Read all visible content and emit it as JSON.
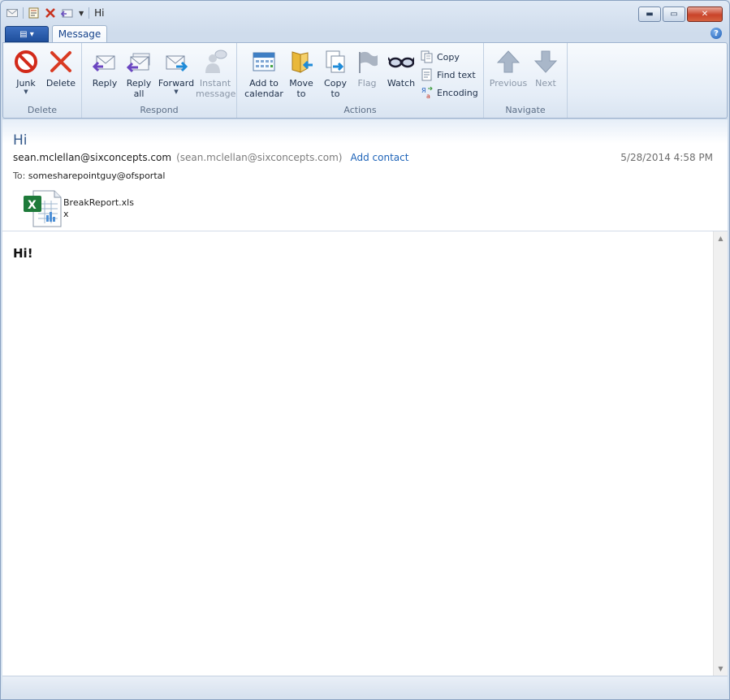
{
  "window": {
    "title": "Hi"
  },
  "ribbon": {
    "app_menu_label": "▤ ▾",
    "tab_message": "Message",
    "groups": {
      "delete": "Delete",
      "respond": "Respond",
      "actions": "Actions",
      "navigate": "Navigate"
    },
    "buttons": {
      "junk": "Junk",
      "delete": "Delete",
      "reply": "Reply",
      "reply_all_1": "Reply",
      "reply_all_2": "all",
      "forward": "Forward",
      "instant_1": "Instant",
      "instant_2": "message",
      "add_cal_1": "Add to",
      "add_cal_2": "calendar",
      "move_1": "Move",
      "move_2": "to",
      "copy_to_1": "Copy",
      "copy_to_2": "to",
      "flag": "Flag",
      "watch": "Watch",
      "copy": "Copy",
      "find_text": "Find text",
      "encoding": "Encoding",
      "previous": "Previous",
      "next": "Next"
    }
  },
  "message": {
    "subject": "Hi",
    "from_display": "sean.mclellan@sixconcepts.com",
    "from_alias": "(sean.mclellan@sixconcepts.com)",
    "add_contact": "Add contact",
    "date": "5/28/2014 4:58 PM",
    "to_label": "To:",
    "to_value": "somesharepointguy@ofsportal",
    "attachment_name": "BreakReport.xlsx",
    "body": "Hi!"
  },
  "colors": {
    "accent": "#15428b",
    "link": "#1d63b8",
    "subject": "#355a8c",
    "close_button": "#c9442a"
  },
  "icons": {
    "junk": "no-entry-icon",
    "delete": "red-x-icon",
    "reply": "envelope-reply-icon",
    "reply_all": "envelope-reply-all-icon",
    "forward": "envelope-forward-icon",
    "instant_message": "people-chat-icon",
    "add_to_calendar": "calendar-icon",
    "move_to": "folder-arrow-icon",
    "copy_to": "document-copy-icon",
    "flag": "flag-icon",
    "watch": "glasses-icon",
    "copy": "copy-icon",
    "find_text": "find-text-icon",
    "encoding": "encoding-icon",
    "previous": "up-arrow-icon",
    "next": "down-arrow-icon",
    "attachment": "excel-file-icon"
  }
}
